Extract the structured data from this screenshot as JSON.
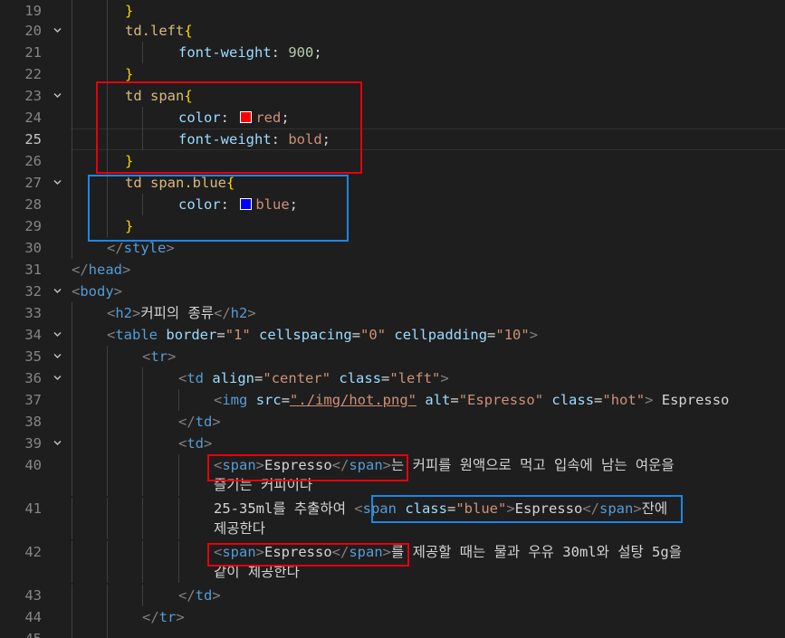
{
  "editor": {
    "lines": [
      {
        "n": "19",
        "text": "}"
      },
      {
        "n": "20",
        "sel": "td.left",
        "brace": "{"
      },
      {
        "n": "21",
        "prop": "font-weight",
        "val": "900"
      },
      {
        "n": "22",
        "text": "}"
      },
      {
        "n": "23",
        "sel": "td span",
        "brace": "{"
      },
      {
        "n": "24",
        "prop": "color",
        "val": "red",
        "swatch": "#ff0000"
      },
      {
        "n": "25",
        "prop": "font-weight",
        "val": "bold"
      },
      {
        "n": "26",
        "text": "}"
      },
      {
        "n": "27",
        "sel": "td span.blue",
        "brace": "{"
      },
      {
        "n": "28",
        "prop": "color",
        "val": "blue",
        "swatch": "#0000ff"
      },
      {
        "n": "29",
        "text": "}"
      },
      {
        "n": "30",
        "tag": "style"
      },
      {
        "n": "31",
        "tag": "head"
      },
      {
        "n": "32",
        "tag": "body"
      },
      {
        "n": "33",
        "tag": "h2",
        "content": "커피의 종류"
      },
      {
        "n": "34",
        "tag": "table",
        "attr1": "border",
        "val1": "\"1\"",
        "attr2": "cellspacing",
        "val2": "\"0\"",
        "attr3": "cellpadding",
        "val3": "\"10\""
      },
      {
        "n": "35",
        "tag": "tr"
      },
      {
        "n": "36",
        "tag": "td",
        "attr1": "align",
        "val1": "\"center\"",
        "attr2": "class",
        "val2": "\"left\""
      },
      {
        "n": "37",
        "tag": "img",
        "attr1": "src",
        "val1": "\"./img/hot.png\"",
        "attr2": "alt",
        "val2": "\"Espresso\"",
        "attr3": "class",
        "val3": "\"hot\"",
        "after": " Espresso"
      },
      {
        "n": "38",
        "tag": "td"
      },
      {
        "n": "39",
        "tag": "td"
      },
      {
        "n": "40",
        "tag": "span",
        "content": "Espresso",
        "text_a": "는 커피를 원액으로 먹고 입속에 남는 여운을",
        "text_b": "즐기는 커피이다"
      },
      {
        "n": "41",
        "pre": "25-35ml를 추출하여 ",
        "tag": "span",
        "attr": "class",
        "val": "\"blue\"",
        "content": "Espresso",
        "text_a": "잔에",
        "text_b": "제공한다"
      },
      {
        "n": "42",
        "tag": "span",
        "content": "Espresso",
        "text_a": "를 제공할 때는 물과 우유 30ml와 설탕 5g을",
        "text_b": "같이 제공한다"
      },
      {
        "n": "43",
        "tag": "td"
      },
      {
        "n": "44",
        "tag": "tr"
      },
      {
        "n": "45"
      }
    ]
  },
  "colors": {
    "background": "#1e1e1e",
    "annotation_red": "#e8000b",
    "annotation_blue": "#1b87e6"
  }
}
